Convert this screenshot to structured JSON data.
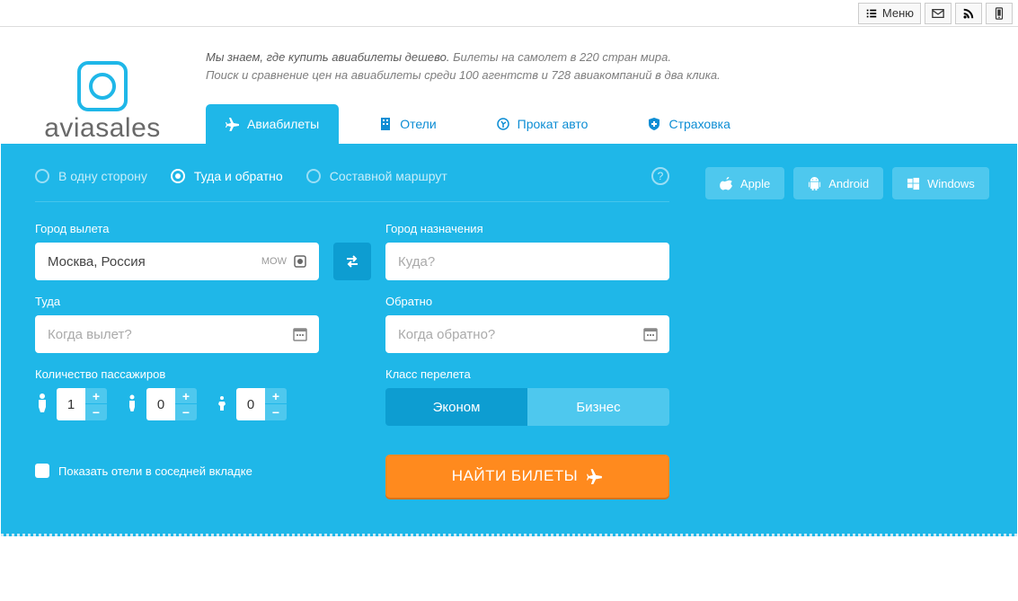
{
  "toolbar": {
    "menu_label": "Меню"
  },
  "brand": "aviasales",
  "tagline": {
    "line1a": "Мы знаем, где купить авиабилеты дешево.",
    "line1b": " Билеты на самолет в 220 стран мира.",
    "line2": "Поиск и сравнение цен на авиабилеты среди 100 агентств и 728 авиакомпаний в два клика."
  },
  "tabs": {
    "flights": "Авиабилеты",
    "hotels": "Отели",
    "cars": "Прокат авто",
    "insurance": "Страховка"
  },
  "trip_type": {
    "one_way": "В одну сторону",
    "round": "Туда и обратно",
    "multi": "Составной маршрут"
  },
  "apps": {
    "apple": "Apple",
    "android": "Android",
    "windows": "Windows"
  },
  "form": {
    "origin_label": "Город вылета",
    "origin_value": "Москва, Россия",
    "origin_code": "MOW",
    "dest_label": "Город назначения",
    "dest_placeholder": "Куда?",
    "depart_label": "Туда",
    "depart_placeholder": "Когда вылет?",
    "return_label": "Обратно",
    "return_placeholder": "Когда обратно?",
    "pax_label": "Количество пассажиров",
    "class_label": "Класс перелета",
    "economy": "Эконом",
    "business": "Бизнес",
    "show_hotels": "Показать отели в соседней вкладке",
    "search": "НАЙТИ БИЛЕТЫ"
  },
  "pax": {
    "adults": "1",
    "children": "0",
    "infants": "0"
  }
}
